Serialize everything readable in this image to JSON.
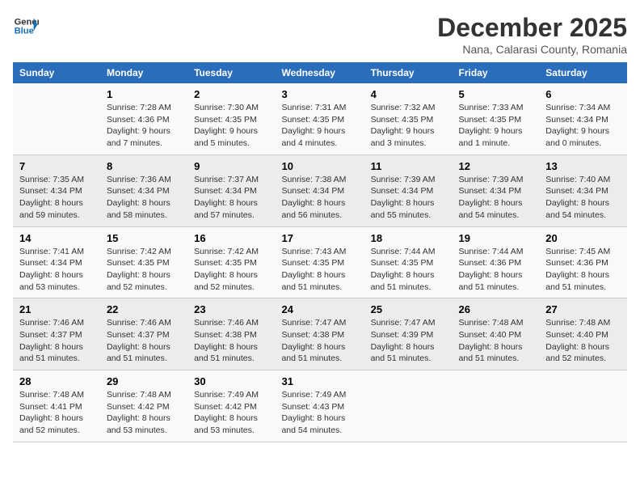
{
  "header": {
    "logo_line1": "General",
    "logo_line2": "Blue",
    "month_year": "December 2025",
    "location": "Nana, Calarasi County, Romania"
  },
  "weekdays": [
    "Sunday",
    "Monday",
    "Tuesday",
    "Wednesday",
    "Thursday",
    "Friday",
    "Saturday"
  ],
  "weeks": [
    [
      {
        "day": "",
        "info": ""
      },
      {
        "day": "1",
        "info": "Sunrise: 7:28 AM\nSunset: 4:36 PM\nDaylight: 9 hours\nand 7 minutes."
      },
      {
        "day": "2",
        "info": "Sunrise: 7:30 AM\nSunset: 4:35 PM\nDaylight: 9 hours\nand 5 minutes."
      },
      {
        "day": "3",
        "info": "Sunrise: 7:31 AM\nSunset: 4:35 PM\nDaylight: 9 hours\nand 4 minutes."
      },
      {
        "day": "4",
        "info": "Sunrise: 7:32 AM\nSunset: 4:35 PM\nDaylight: 9 hours\nand 3 minutes."
      },
      {
        "day": "5",
        "info": "Sunrise: 7:33 AM\nSunset: 4:35 PM\nDaylight: 9 hours\nand 1 minute."
      },
      {
        "day": "6",
        "info": "Sunrise: 7:34 AM\nSunset: 4:34 PM\nDaylight: 9 hours\nand 0 minutes."
      }
    ],
    [
      {
        "day": "7",
        "info": "Sunrise: 7:35 AM\nSunset: 4:34 PM\nDaylight: 8 hours\nand 59 minutes."
      },
      {
        "day": "8",
        "info": "Sunrise: 7:36 AM\nSunset: 4:34 PM\nDaylight: 8 hours\nand 58 minutes."
      },
      {
        "day": "9",
        "info": "Sunrise: 7:37 AM\nSunset: 4:34 PM\nDaylight: 8 hours\nand 57 minutes."
      },
      {
        "day": "10",
        "info": "Sunrise: 7:38 AM\nSunset: 4:34 PM\nDaylight: 8 hours\nand 56 minutes."
      },
      {
        "day": "11",
        "info": "Sunrise: 7:39 AM\nSunset: 4:34 PM\nDaylight: 8 hours\nand 55 minutes."
      },
      {
        "day": "12",
        "info": "Sunrise: 7:39 AM\nSunset: 4:34 PM\nDaylight: 8 hours\nand 54 minutes."
      },
      {
        "day": "13",
        "info": "Sunrise: 7:40 AM\nSunset: 4:34 PM\nDaylight: 8 hours\nand 54 minutes."
      }
    ],
    [
      {
        "day": "14",
        "info": "Sunrise: 7:41 AM\nSunset: 4:34 PM\nDaylight: 8 hours\nand 53 minutes."
      },
      {
        "day": "15",
        "info": "Sunrise: 7:42 AM\nSunset: 4:35 PM\nDaylight: 8 hours\nand 52 minutes."
      },
      {
        "day": "16",
        "info": "Sunrise: 7:42 AM\nSunset: 4:35 PM\nDaylight: 8 hours\nand 52 minutes."
      },
      {
        "day": "17",
        "info": "Sunrise: 7:43 AM\nSunset: 4:35 PM\nDaylight: 8 hours\nand 51 minutes."
      },
      {
        "day": "18",
        "info": "Sunrise: 7:44 AM\nSunset: 4:35 PM\nDaylight: 8 hours\nand 51 minutes."
      },
      {
        "day": "19",
        "info": "Sunrise: 7:44 AM\nSunset: 4:36 PM\nDaylight: 8 hours\nand 51 minutes."
      },
      {
        "day": "20",
        "info": "Sunrise: 7:45 AM\nSunset: 4:36 PM\nDaylight: 8 hours\nand 51 minutes."
      }
    ],
    [
      {
        "day": "21",
        "info": "Sunrise: 7:46 AM\nSunset: 4:37 PM\nDaylight: 8 hours\nand 51 minutes."
      },
      {
        "day": "22",
        "info": "Sunrise: 7:46 AM\nSunset: 4:37 PM\nDaylight: 8 hours\nand 51 minutes."
      },
      {
        "day": "23",
        "info": "Sunrise: 7:46 AM\nSunset: 4:38 PM\nDaylight: 8 hours\nand 51 minutes."
      },
      {
        "day": "24",
        "info": "Sunrise: 7:47 AM\nSunset: 4:38 PM\nDaylight: 8 hours\nand 51 minutes."
      },
      {
        "day": "25",
        "info": "Sunrise: 7:47 AM\nSunset: 4:39 PM\nDaylight: 8 hours\nand 51 minutes."
      },
      {
        "day": "26",
        "info": "Sunrise: 7:48 AM\nSunset: 4:40 PM\nDaylight: 8 hours\nand 51 minutes."
      },
      {
        "day": "27",
        "info": "Sunrise: 7:48 AM\nSunset: 4:40 PM\nDaylight: 8 hours\nand 52 minutes."
      }
    ],
    [
      {
        "day": "28",
        "info": "Sunrise: 7:48 AM\nSunset: 4:41 PM\nDaylight: 8 hours\nand 52 minutes."
      },
      {
        "day": "29",
        "info": "Sunrise: 7:48 AM\nSunset: 4:42 PM\nDaylight: 8 hours\nand 53 minutes."
      },
      {
        "day": "30",
        "info": "Sunrise: 7:49 AM\nSunset: 4:42 PM\nDaylight: 8 hours\nand 53 minutes."
      },
      {
        "day": "31",
        "info": "Sunrise: 7:49 AM\nSunset: 4:43 PM\nDaylight: 8 hours\nand 54 minutes."
      },
      {
        "day": "",
        "info": ""
      },
      {
        "day": "",
        "info": ""
      },
      {
        "day": "",
        "info": ""
      }
    ]
  ]
}
